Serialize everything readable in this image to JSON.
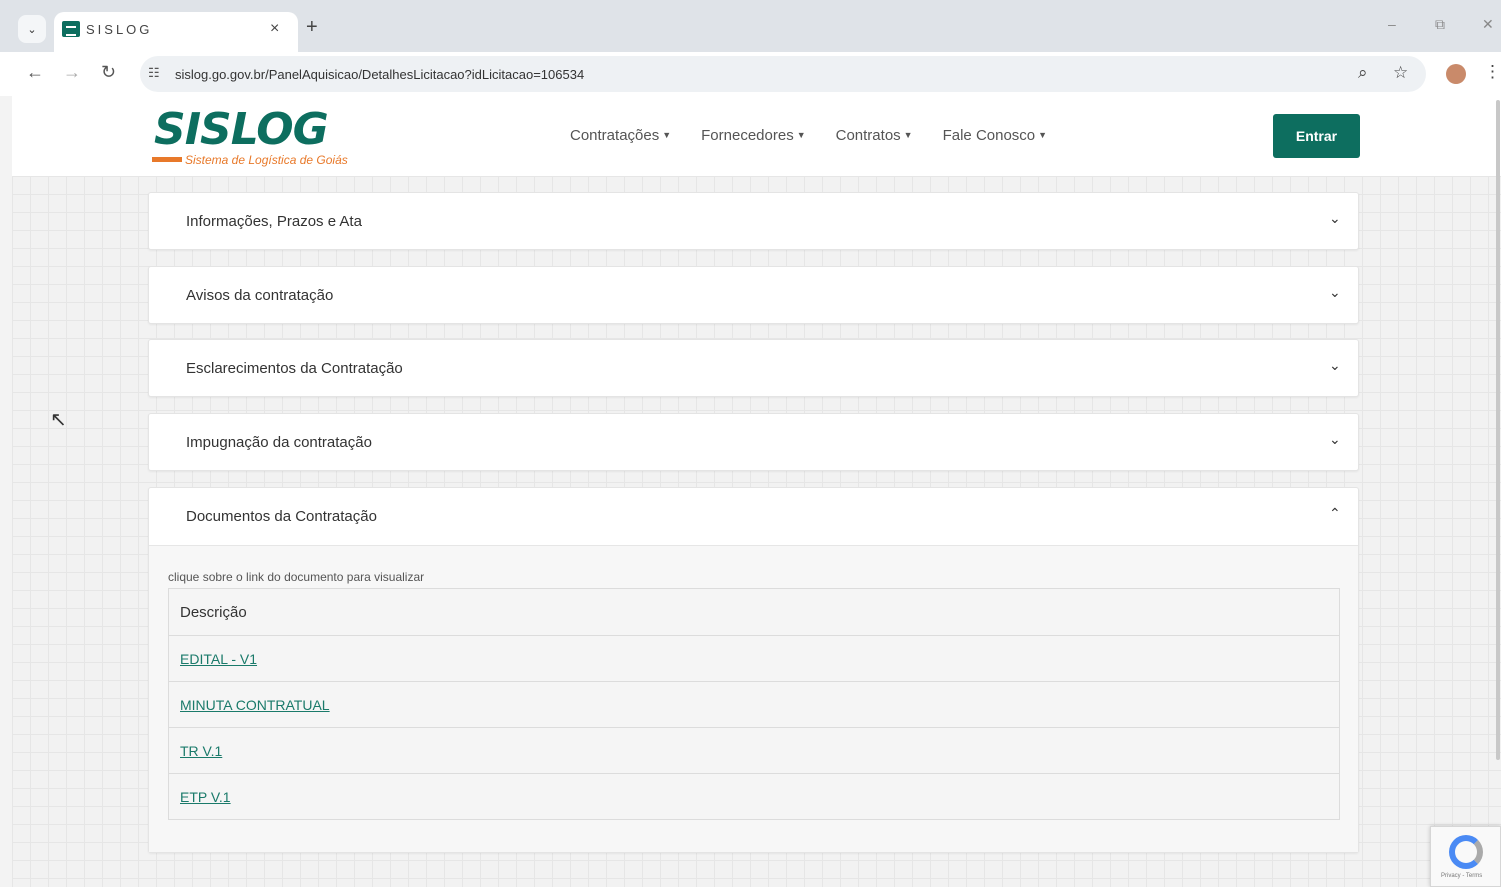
{
  "browser": {
    "tab_title": "SISLOG",
    "url": "sislog.go.gov.br/PanelAquisicao/DetalhesLicitacao?idLicitacao=106534",
    "tab_list_icon": "⌄",
    "close_icon": "×",
    "new_tab_icon": "+",
    "back_icon": "←",
    "forward_icon": "→",
    "reload_icon": "↻",
    "site_info_icon": "☷",
    "zoom_icon": "⌕",
    "bookmark_icon": "☆",
    "menu_icon": "⋮",
    "minimize_icon": "–",
    "restore_icon": "⧉",
    "close_window_icon": "✕"
  },
  "header": {
    "logo_text": "SISLOG",
    "logo_subtitle": "Sistema de Logística de Goiás",
    "nav": [
      {
        "label": "Contratações"
      },
      {
        "label": "Fornecedores"
      },
      {
        "label": "Contratos"
      },
      {
        "label": "Fale Conosco"
      }
    ],
    "caret": "▼",
    "login_label": "Entrar"
  },
  "sections": [
    {
      "title": "Informações, Prazos e Ata"
    },
    {
      "title": "Avisos da contratação"
    },
    {
      "title": "Esclarecimentos da Contratação"
    },
    {
      "title": "Impugnação da contratação"
    }
  ],
  "chevron_down": "⌄",
  "chevron_up": "⌃",
  "documents": {
    "title": "Documentos da Contratação",
    "hint": "clique sobre o link do documento para visualizar",
    "column_header": "Descrição",
    "items": [
      "EDITAL - V1",
      "MINUTA CONTRATUAL",
      "TR V.1",
      "ETP V.1"
    ]
  },
  "recaptcha": {
    "text": "Privacy - Terms"
  },
  "colors": {
    "brand": "#0d6e5f",
    "accent": "#e8792a",
    "link": "#1a7a6a"
  }
}
